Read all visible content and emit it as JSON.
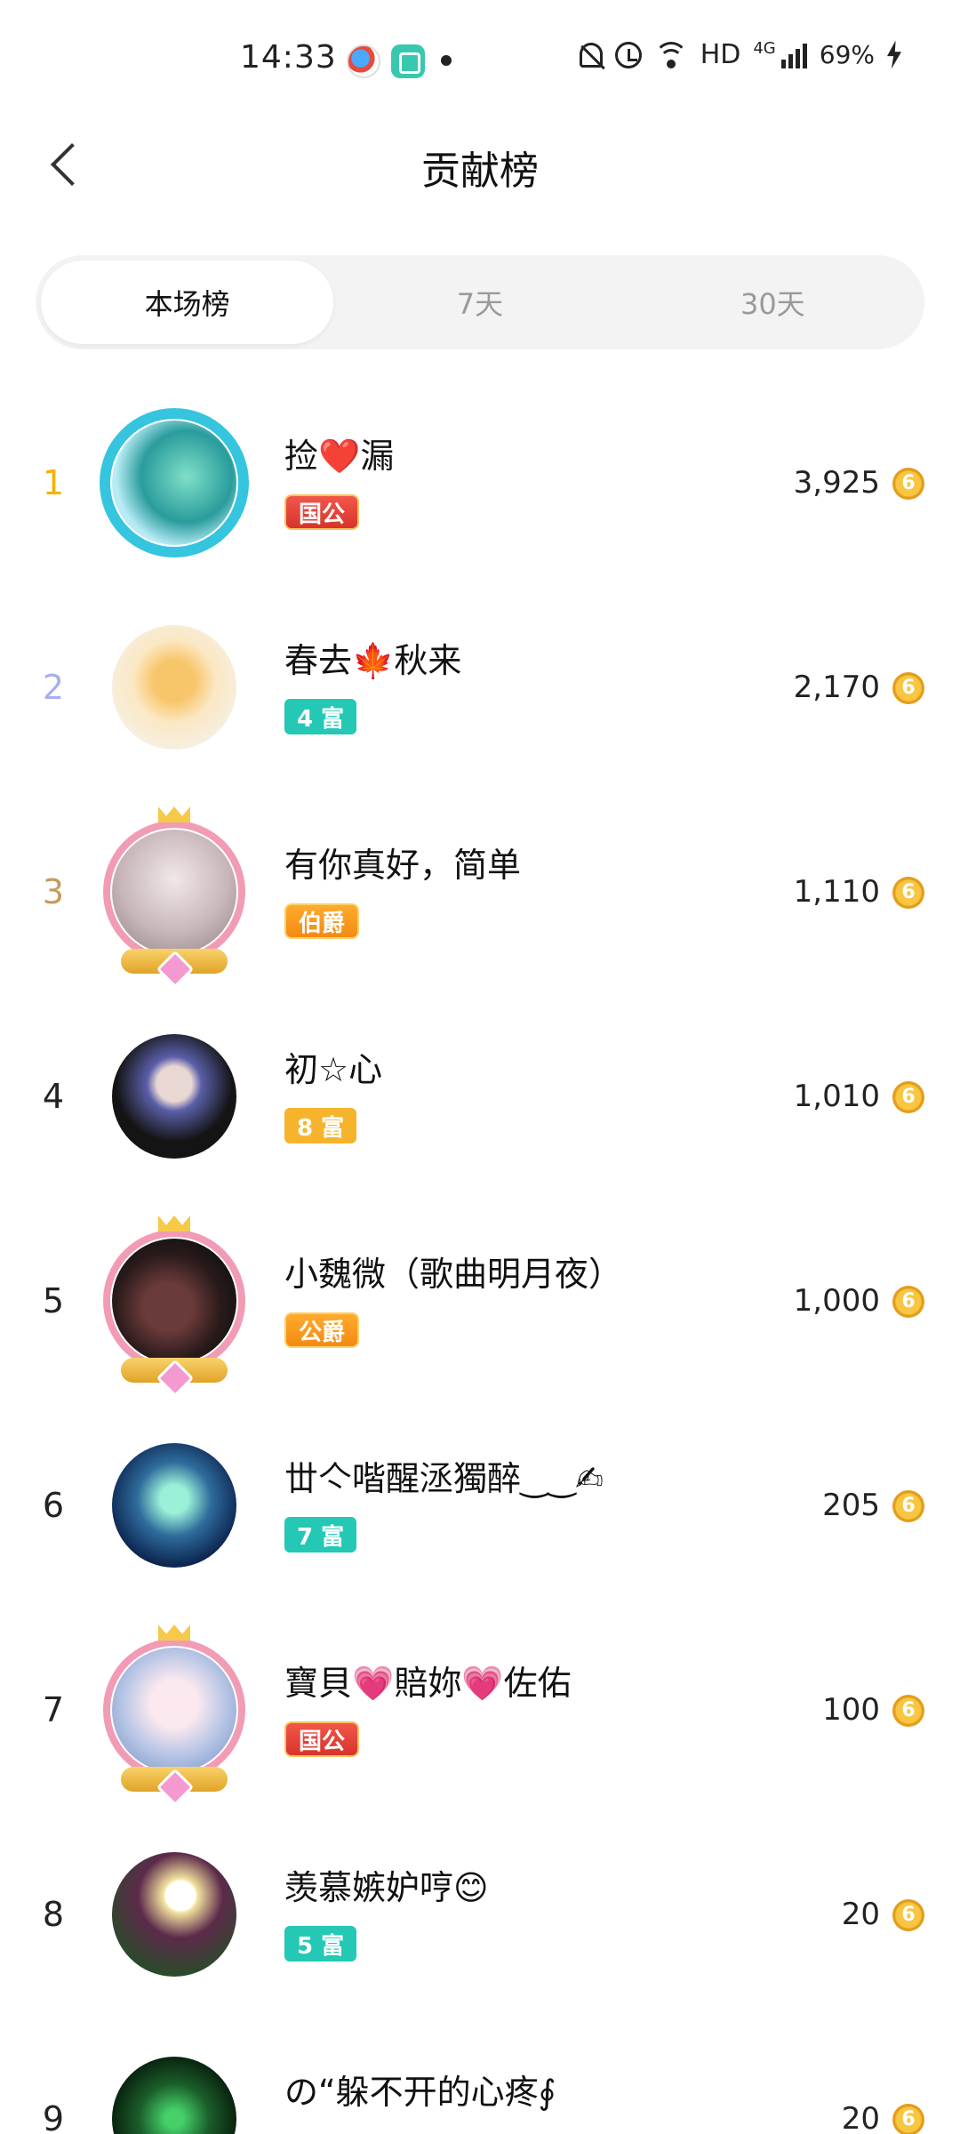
{
  "status_bar": {
    "time": "14:33",
    "network": "HD",
    "signal_label": "4G",
    "battery": "69%"
  },
  "header": {
    "title": "贡献榜"
  },
  "tabs": [
    {
      "label": "本场榜",
      "active": true
    },
    {
      "label": "7天",
      "active": false
    },
    {
      "label": "30天",
      "active": false
    }
  ],
  "ranking": [
    {
      "rank": "1",
      "name": "捡❤️漏",
      "badge": "国公",
      "score": "3,925"
    },
    {
      "rank": "2",
      "name": "春去🍁秋来",
      "badge": "4 富",
      "score": "2,170"
    },
    {
      "rank": "3",
      "name": "有你真好，简单",
      "badge": "伯爵",
      "score": "1,110"
    },
    {
      "rank": "4",
      "name": "初☆心",
      "badge": "8 富",
      "score": "1,010"
    },
    {
      "rank": "5",
      "name": "小魏微（歌曲明月夜）",
      "badge": "公爵",
      "score": "1,000"
    },
    {
      "rank": "6",
      "name": "丗亽喈醒洆獨醉‿‿✍",
      "badge": "7 富",
      "score": "205"
    },
    {
      "rank": "7",
      "name": "寶貝💗賠妳💗佐佑",
      "badge": "国公",
      "score": "100"
    },
    {
      "rank": "8",
      "name": "羡慕嫉妒哼😊",
      "badge": "5 富",
      "score": "20"
    },
    {
      "rank": "9",
      "name": "の“躲不开的心疼∮",
      "badge": "",
      "score": "20"
    }
  ]
}
